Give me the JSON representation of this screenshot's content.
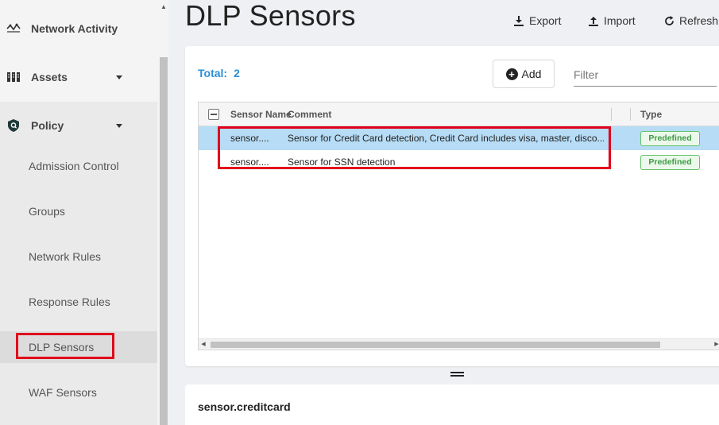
{
  "sidebar": {
    "items": [
      {
        "label": "Network Activity",
        "icon": "network-activity-icon"
      },
      {
        "label": "Assets",
        "icon": "assets-icon"
      },
      {
        "label": "Policy",
        "icon": "policy-shield-icon"
      }
    ],
    "policy_sub": [
      {
        "label": "Admission Control"
      },
      {
        "label": "Groups"
      },
      {
        "label": "Network Rules"
      },
      {
        "label": "Response Rules"
      },
      {
        "label": "DLP Sensors"
      },
      {
        "label": "WAF Sensors"
      }
    ]
  },
  "header": {
    "title": "DLP Sensors",
    "export_label": "Export",
    "import_label": "Import",
    "refresh_label": "Refresh"
  },
  "toolbar": {
    "total_label": "Total:",
    "total_value": "2",
    "add_label": "Add",
    "filter_placeholder": "Filter"
  },
  "table": {
    "columns": {
      "name": "Sensor Name",
      "comment": "Comment",
      "type": "Type"
    },
    "rows": [
      {
        "name": "sensor....",
        "comment": "Sensor for Credit Card detection, Credit Card includes visa, master, disco...",
        "type": "Predefined",
        "selected": true
      },
      {
        "name": "sensor....",
        "comment": "Sensor for SSN detection",
        "type": "Predefined",
        "selected": false
      }
    ]
  },
  "detail": {
    "title": "sensor.creditcard"
  },
  "colors": {
    "accent": "#2b8fd6",
    "selected_row": "#b7dcf5",
    "badge_green": "#3e9b43",
    "highlight_red": "#e0001b"
  }
}
